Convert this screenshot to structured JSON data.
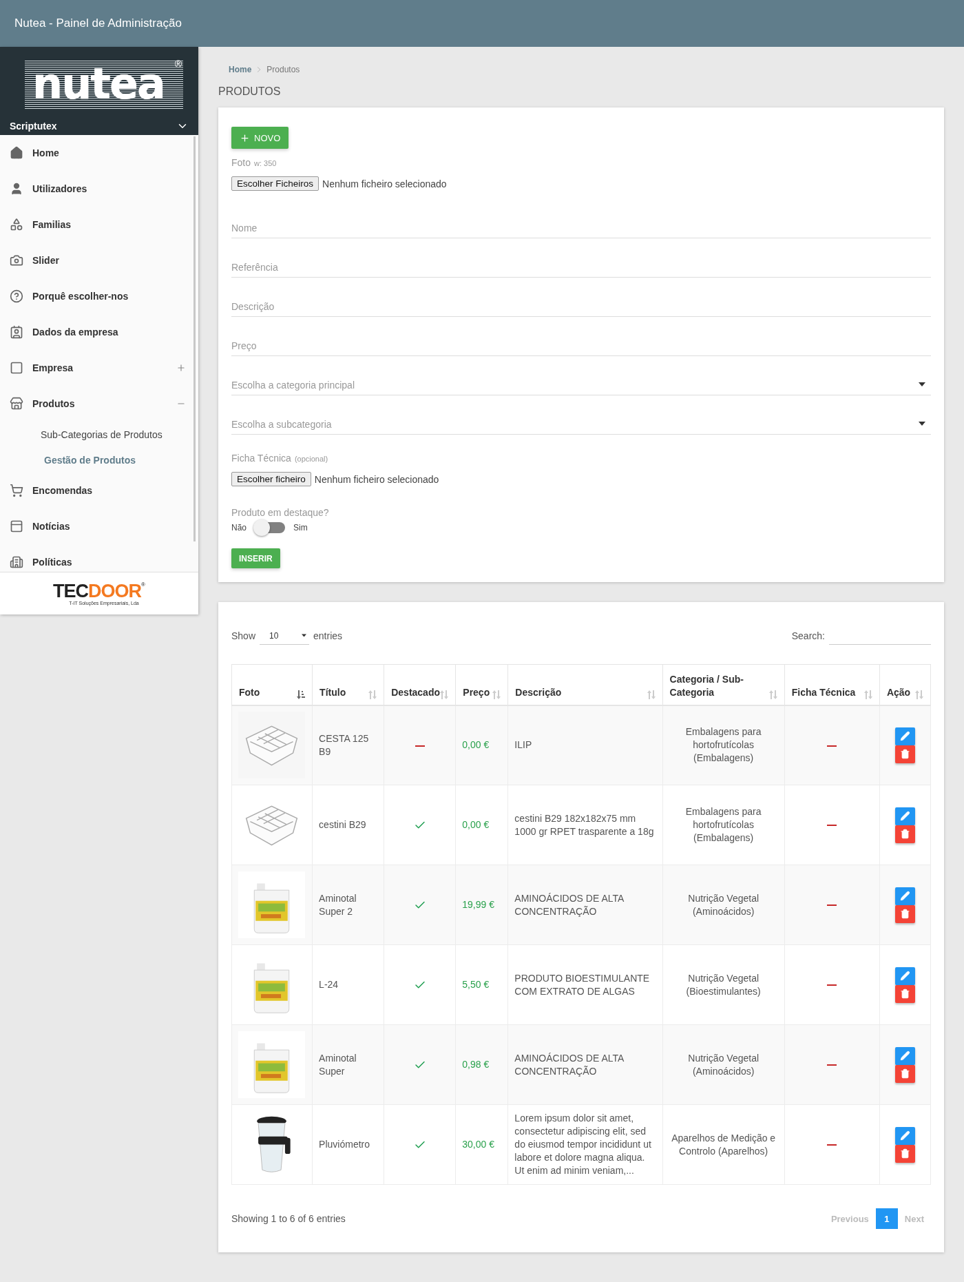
{
  "topbar": {
    "title": "Nutea - Painel de Administração"
  },
  "sidebar": {
    "logo": "nutea",
    "logo_mark": "®",
    "user": "Scriptutex",
    "items": [
      {
        "label": "Home",
        "selected": false
      },
      {
        "label": "Utilizadores",
        "selected": false
      },
      {
        "label": "Familias",
        "selected": false
      },
      {
        "label": "Slider",
        "selected": false
      },
      {
        "label": "Porquê escolher-nos",
        "selected": false
      },
      {
        "label": "Dados da empresa",
        "selected": false
      },
      {
        "label": "Empresa",
        "selected": false,
        "expanded": false
      },
      {
        "label": "Produtos",
        "selected": false,
        "expanded": true,
        "children": [
          {
            "label": "Sub-Categorias de Produtos",
            "selected": false
          },
          {
            "label": "Gestão de Produtos",
            "selected": true
          }
        ]
      },
      {
        "label": "Encomendas",
        "selected": false
      },
      {
        "label": "Notícias",
        "selected": false
      },
      {
        "label": "Políticas",
        "selected": false
      }
    ],
    "footer": {
      "logo_a": "TEC",
      "logo_b": "DOOR",
      "logo_mark": "®",
      "tagline": "T-IT Soluções Empresariais, Lda"
    }
  },
  "breadcrumb": [
    {
      "label": "Home"
    },
    {
      "label": "Produtos"
    }
  ],
  "page_title": "PRODUTOS",
  "form": {
    "new_button": "NOVO",
    "photo_label": "Foto",
    "photo_hint": "w: 350",
    "photo_file": {
      "button": "Escolher Ficheiros",
      "status": "Nenhum ficheiro selecionado"
    },
    "fields": [
      {
        "kind": "text",
        "placeholder": "Nome"
      },
      {
        "kind": "text",
        "placeholder": "Referência"
      },
      {
        "kind": "text",
        "placeholder": "Descrição"
      },
      {
        "kind": "text",
        "placeholder": "Preço"
      },
      {
        "kind": "select",
        "placeholder": "Escolha a categoria principal"
      },
      {
        "kind": "select",
        "placeholder": "Escolha a subcategoria"
      }
    ],
    "sheet_label": "Ficha Técnica",
    "sheet_hint": "(opcional)",
    "sheet_file": {
      "button": "Escolher ficheiro",
      "status": "Nenhum ficheiro selecionado"
    },
    "featured_label": "Produto em destaque?",
    "featured_off": "Não",
    "featured_on": "Sim",
    "featured": false,
    "submit": "INSERIR"
  },
  "table": {
    "show_label": "Show",
    "page_size": "10",
    "entries_label": "entries",
    "search_label": "Search:",
    "columns": [
      {
        "label": "Foto",
        "sorted": true
      },
      {
        "label": "Título",
        "sorted": false
      },
      {
        "label": "Destacado",
        "sorted": false
      },
      {
        "label": "Preço",
        "sorted": false
      },
      {
        "label": "Descrição",
        "sorted": false
      },
      {
        "label": "Categoria / Sub-Categoria",
        "sorted": false
      },
      {
        "label": "Ficha Técnica",
        "sorted": false
      },
      {
        "label": "Ação",
        "sorted": false
      }
    ],
    "rows": [
      {
        "title": "CESTA 125 B9",
        "featured": false,
        "price": "0,00 €",
        "description": "ILIP",
        "category": "Embalagens para hortofrutícolas (Embalagens)",
        "has_sheet": false
      },
      {
        "title": "cestini B29",
        "featured": true,
        "price": "0,00 €",
        "description": "cestini B29 182x182x75 mm 1000 gr RPET trasparente a 18g",
        "category": "Embalagens para hortofrutícolas (Embalagens)",
        "has_sheet": false
      },
      {
        "title": "Aminotal Super 2",
        "featured": true,
        "price": "19,99 €",
        "description": "AMINOÁCIDOS DE ALTA CONCENTRAÇÃO",
        "category": "Nutrição Vegetal (Aminoácidos)",
        "has_sheet": false
      },
      {
        "title": "L-24",
        "featured": true,
        "price": "5,50 €",
        "description": "PRODUTO BIOESTIMULANTE COM EXTRATO DE ALGAS",
        "category": "Nutrição Vegetal (Bioestimulantes)",
        "has_sheet": false
      },
      {
        "title": "Aminotal Super",
        "featured": true,
        "price": "0,98 €",
        "description": "AMINOÁCIDOS DE ALTA CONCENTRAÇÃO",
        "category": "Nutrição Vegetal (Aminoácidos)",
        "has_sheet": false
      },
      {
        "title": "Pluviómetro",
        "featured": true,
        "price": "30,00 €",
        "description": "Lorem ipsum dolor sit amet, consectetur adipiscing elit, sed do eiusmod tempor incididunt ut labore et dolore magna aliqua. Ut enim ad minim veniam,...",
        "category": "Aparelhos de Medição e Controlo (Aparelhos)",
        "has_sheet": false
      }
    ],
    "info": "Showing 1 to 6 of 6 entries",
    "pagination": [
      {
        "label": "Previous",
        "disabled": true,
        "selected": false
      },
      {
        "label": "1",
        "disabled": false,
        "selected": true
      },
      {
        "label": "Next",
        "disabled": true,
        "selected": false
      }
    ]
  }
}
